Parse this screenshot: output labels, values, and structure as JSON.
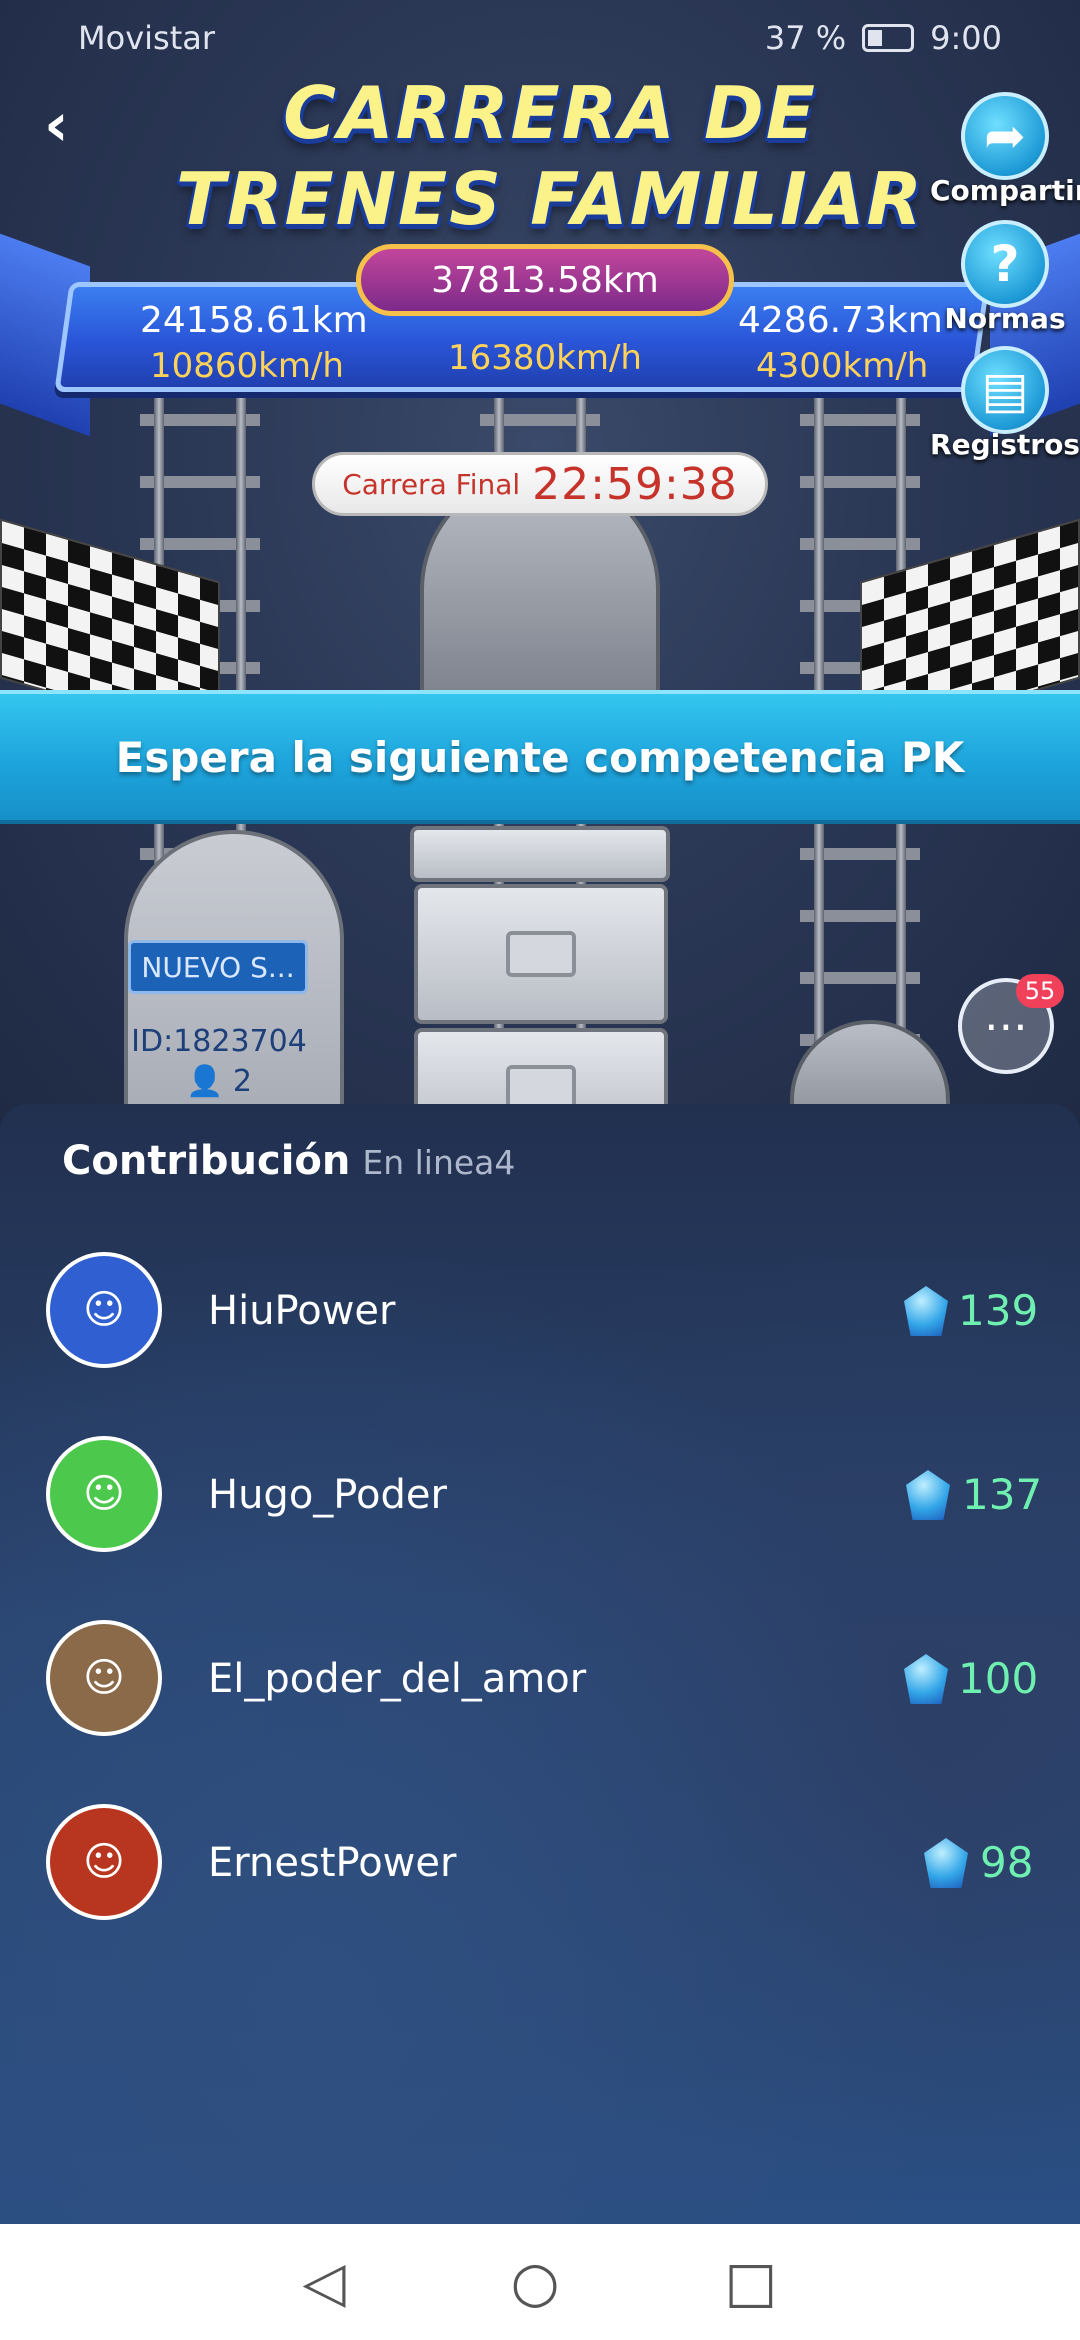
{
  "status_bar": {
    "carrier": "Movistar",
    "battery_text": "37 %",
    "time": "9:00"
  },
  "header": {
    "title_line1": "CARRERA DE",
    "title_line2": "TRENES FAMILIAR",
    "total_distance": "37813.58km",
    "left_distance": "24158.61km",
    "left_speed": "10860km/h",
    "center_speed": "16380km/h",
    "right_distance": "4286.73km",
    "right_speed": "4300km/h"
  },
  "side_buttons": {
    "share": "Compartir",
    "rules": "Normas",
    "records": "Registros"
  },
  "timer": {
    "label": "Carrera Final",
    "value": "22:59:38"
  },
  "wait_banner": "Espera la siguiente competencia PK",
  "team": {
    "name": "NUEVO S...",
    "id": "ID:1823704",
    "members": "2"
  },
  "chat": {
    "badge": "55"
  },
  "contribution": {
    "title": "Contribución",
    "online_label": "En linea4",
    "users": [
      {
        "name": "HiuPower",
        "score": "139",
        "avatar_color": "#2f5fd0"
      },
      {
        "name": "Hugo_Poder",
        "score": "137",
        "avatar_color": "#4cc94c"
      },
      {
        "name": "El_poder_del_amor",
        "score": "100",
        "avatar_color": "#8a6a48"
      },
      {
        "name": "ErnestPower",
        "score": "98",
        "avatar_color": "#b8361f"
      }
    ]
  },
  "colors": {
    "score_green": "#6ff0b0",
    "banner_blue": "#1ea4dc",
    "title_yellow": "#fbf28a"
  }
}
